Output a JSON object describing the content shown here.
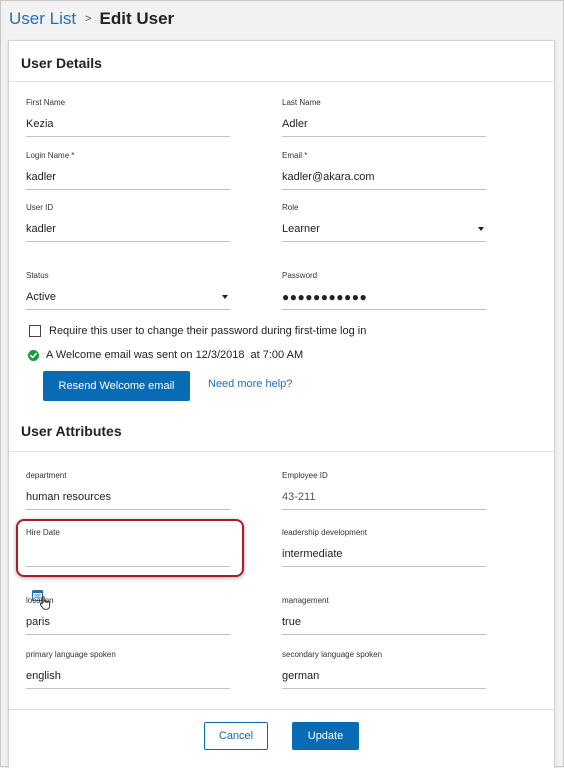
{
  "breadcrumb": {
    "parent": "User List",
    "separator": ">",
    "current": "Edit User"
  },
  "user_details": {
    "title": "User Details",
    "first_name": {
      "label": "First Name",
      "value": "Kezia"
    },
    "last_name": {
      "label": "Last Name",
      "value": "Adler"
    },
    "login_name": {
      "label": "Login Name *",
      "value": "kadler"
    },
    "email": {
      "label": "Email *",
      "value": "kadler@akara.com"
    },
    "user_id": {
      "label": "User ID",
      "value": "kadler"
    },
    "role": {
      "label": "Role",
      "value": "Learner"
    },
    "status": {
      "label": "Status",
      "value": "Active"
    },
    "password": {
      "label": "Password",
      "value": "●●●●●●●●●●●"
    },
    "require_change": {
      "label": "Require this user to change their password during first-time log in",
      "checked": false
    },
    "welcome": {
      "text": "A Welcome email was sent on 12/3/2018",
      "time": "at 7:00 AM"
    },
    "resend_label": "Resend Welcome email",
    "help_label": "Need more help?"
  },
  "user_attributes": {
    "title": "User Attributes",
    "department": {
      "label": "department",
      "value": "human resources"
    },
    "employee_id": {
      "label": "Employee ID",
      "value": "43-211"
    },
    "hire_date": {
      "label": "Hire Date",
      "value": ""
    },
    "leadership_development": {
      "label": "leadership development",
      "value": "intermediate"
    },
    "location": {
      "label": "location",
      "value": "paris"
    },
    "management": {
      "label": "management",
      "value": "true"
    },
    "primary_language": {
      "label": "primary language spoken",
      "value": "english"
    },
    "secondary_language": {
      "label": "secondary language spoken",
      "value": "german"
    }
  },
  "footer": {
    "cancel_label": "Cancel",
    "update_label": "Update"
  },
  "colors": {
    "accent": "#0a6bb5",
    "link": "#1f6fb7",
    "highlight": "#a61d2b",
    "success": "#1e9a3c"
  },
  "icons": {
    "check": "check-circle-icon",
    "calendar": "calendar-icon",
    "cursor": "hand-pointer-icon",
    "dropdown": "caret-down-icon"
  }
}
